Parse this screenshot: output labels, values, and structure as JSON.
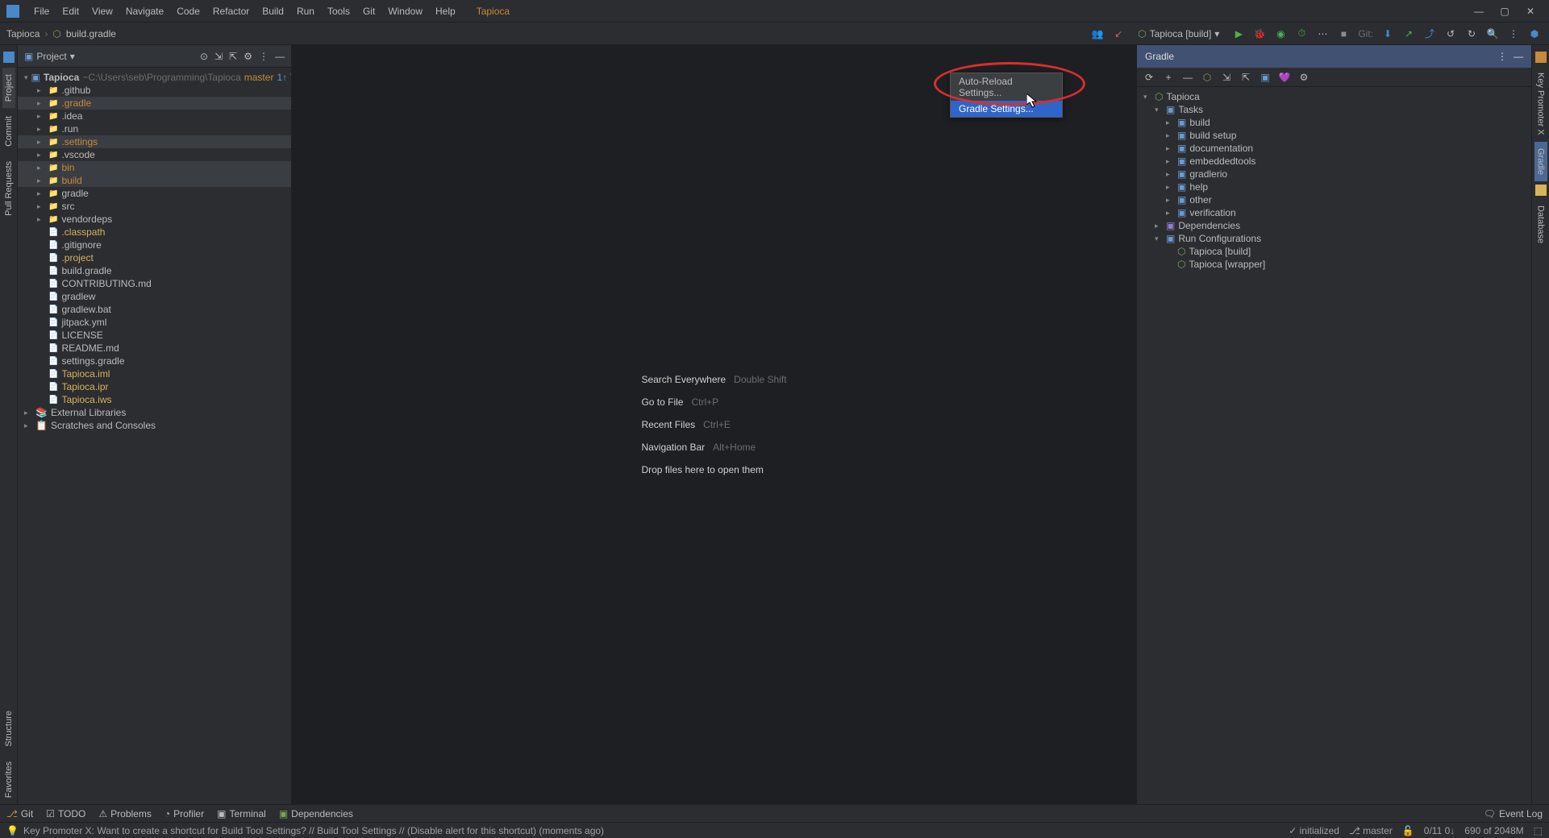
{
  "menu": [
    "File",
    "Edit",
    "View",
    "Navigate",
    "Code",
    "Refactor",
    "Build",
    "Run",
    "Tools",
    "Git",
    "Window",
    "Help"
  ],
  "project_name": "Tapioca",
  "breadcrumb": {
    "root": "Tapioca",
    "file": "build.gradle"
  },
  "toolbar": {
    "run_config": "Tapioca [build]",
    "git_label": "Git:"
  },
  "project_panel": {
    "title": "Project",
    "root": {
      "name": "Tapioca",
      "path": "~C:\\Users\\seb\\Programming\\Tapioca",
      "branch": "master",
      "badge": "1↑"
    },
    "items": [
      {
        "name": ".github",
        "type": "folder",
        "indent": 1,
        "arrow": "r"
      },
      {
        "name": ".gradle",
        "type": "folder",
        "indent": 1,
        "arrow": "r",
        "orange": true,
        "sel": true
      },
      {
        "name": ".idea",
        "type": "folder",
        "indent": 1,
        "arrow": "r"
      },
      {
        "name": ".run",
        "type": "folder",
        "indent": 1,
        "arrow": "r"
      },
      {
        "name": ".settings",
        "type": "folder",
        "indent": 1,
        "arrow": "r",
        "orange": true,
        "sel": true
      },
      {
        "name": ".vscode",
        "type": "folder",
        "indent": 1,
        "arrow": "r"
      },
      {
        "name": "bin",
        "type": "folder",
        "indent": 1,
        "arrow": "r",
        "orange": true,
        "sel": true
      },
      {
        "name": "build",
        "type": "folder",
        "indent": 1,
        "arrow": "r",
        "orange": true,
        "sel": true
      },
      {
        "name": "gradle",
        "type": "folder",
        "indent": 1,
        "arrow": "r"
      },
      {
        "name": "src",
        "type": "folder-blue",
        "indent": 1,
        "arrow": "r"
      },
      {
        "name": "vendordeps",
        "type": "folder",
        "indent": 1,
        "arrow": "r"
      },
      {
        "name": ".classpath",
        "type": "file",
        "indent": 1,
        "yellow": true
      },
      {
        "name": ".gitignore",
        "type": "file",
        "indent": 1
      },
      {
        "name": ".project",
        "type": "file",
        "indent": 1,
        "yellow": true
      },
      {
        "name": "build.gradle",
        "type": "file",
        "indent": 1
      },
      {
        "name": "CONTRIBUTING.md",
        "type": "file",
        "indent": 1
      },
      {
        "name": "gradlew",
        "type": "file",
        "indent": 1
      },
      {
        "name": "gradlew.bat",
        "type": "file",
        "indent": 1
      },
      {
        "name": "jitpack.yml",
        "type": "file",
        "indent": 1
      },
      {
        "name": "LICENSE",
        "type": "file",
        "indent": 1
      },
      {
        "name": "README.md",
        "type": "file",
        "indent": 1
      },
      {
        "name": "settings.gradle",
        "type": "file",
        "indent": 1
      },
      {
        "name": "Tapioca.iml",
        "type": "file",
        "indent": 1,
        "yellow": true
      },
      {
        "name": "Tapioca.ipr",
        "type": "file",
        "indent": 1,
        "yellow": true
      },
      {
        "name": "Tapioca.iws",
        "type": "file",
        "indent": 1,
        "yellow": true
      }
    ],
    "external_libs": "External Libraries",
    "scratches": "Scratches and Consoles"
  },
  "editor_hints": [
    {
      "label": "Search Everywhere",
      "key": "Double Shift"
    },
    {
      "label": "Go to File",
      "key": "Ctrl+P"
    },
    {
      "label": "Recent Files",
      "key": "Ctrl+E"
    },
    {
      "label": "Navigation Bar",
      "key": "Alt+Home"
    },
    {
      "label": "Drop files here to open them",
      "key": ""
    }
  ],
  "gradle_panel": {
    "title": "Gradle",
    "root": "Tapioca",
    "tasks_label": "Tasks",
    "tasks": [
      "build",
      "build setup",
      "documentation",
      "embeddedtools",
      "gradlerio",
      "help",
      "other",
      "verification"
    ],
    "deps": "Dependencies",
    "run_configs_label": "Run Configurations",
    "run_configs": [
      "Tapioca [build]",
      "Tapioca [wrapper]"
    ]
  },
  "popup": {
    "item1": "Auto-Reload Settings...",
    "item2": "Gradle Settings..."
  },
  "left_gutter": [
    "Project",
    "Commit",
    "Pull Requests",
    "Structure",
    "Favorites"
  ],
  "right_gutter": [
    "Key Promoter X",
    "Gradle",
    "Database"
  ],
  "bottom_strip": {
    "git": "Git",
    "todo": "TODO",
    "problems": "Problems",
    "profiler": "Profiler",
    "terminal": "Terminal",
    "deps": "Dependencies",
    "event_log": "Event Log"
  },
  "status": {
    "msg": "Key Promoter X: Want to create a shortcut for Build Tool Settings? // Build Tool Settings // (Disable alert for this shortcut) (moments ago)",
    "initialized": "initialized",
    "branch": "master",
    "counters": "0/11 0↓",
    "mem": "690 of 2048M"
  }
}
